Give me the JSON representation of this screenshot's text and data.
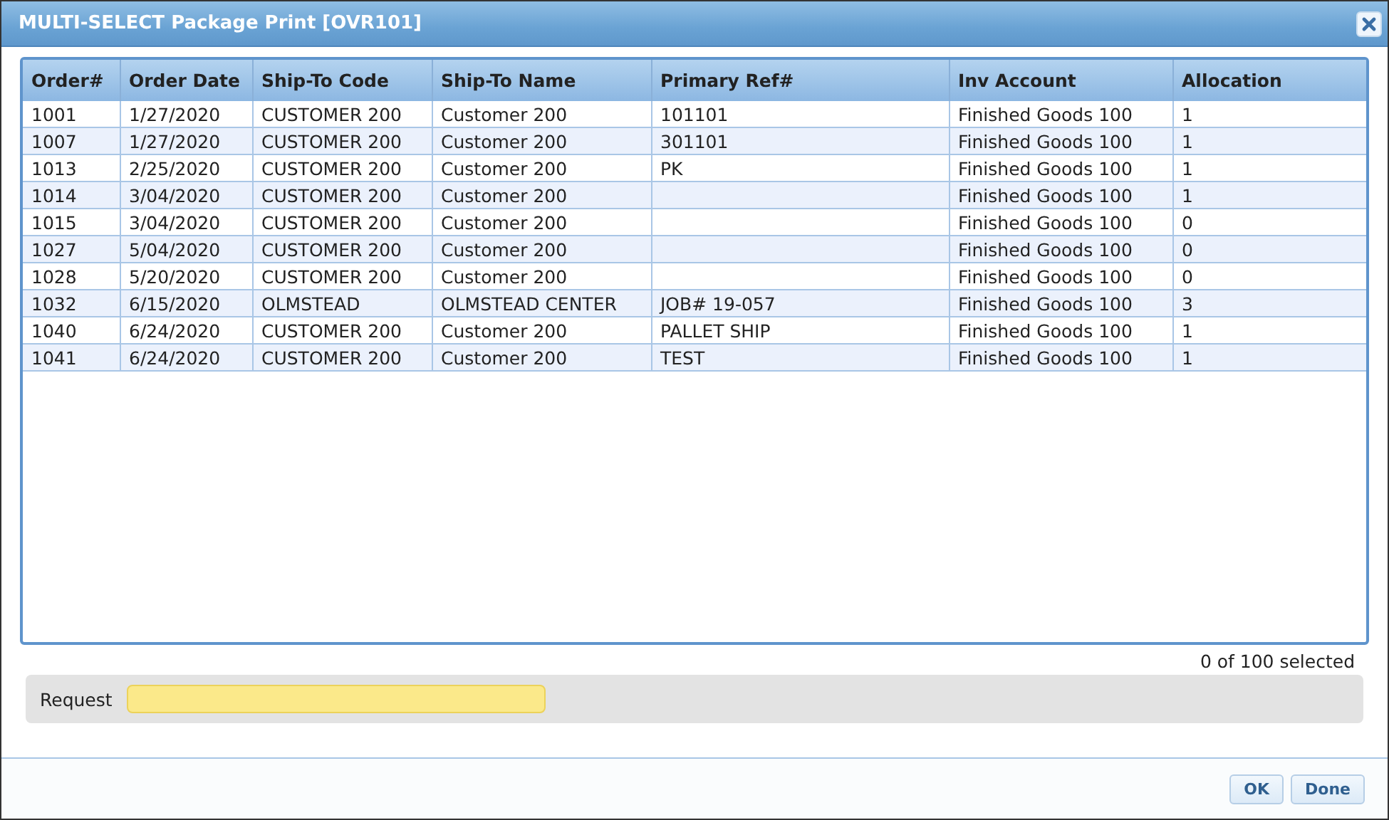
{
  "window": {
    "title": "MULTI-SELECT Package Print [OVR101]"
  },
  "table": {
    "columns": [
      "Order#",
      "Order Date",
      "Ship-To Code",
      "Ship-To Name",
      "Primary Ref#",
      "Inv Account",
      "Allocation"
    ],
    "rows": [
      [
        "1001",
        "1/27/2020",
        "CUSTOMER 200",
        "Customer 200",
        "101101",
        "Finished Goods 100",
        "1"
      ],
      [
        "1007",
        "1/27/2020",
        "CUSTOMER 200",
        "Customer 200",
        "301101",
        "Finished Goods 100",
        "1"
      ],
      [
        "1013",
        "2/25/2020",
        "CUSTOMER 200",
        "Customer 200",
        "PK",
        "Finished Goods 100",
        "1"
      ],
      [
        "1014",
        "3/04/2020",
        "CUSTOMER 200",
        "Customer 200",
        null,
        "Finished Goods 100",
        "1"
      ],
      [
        "1015",
        "3/04/2020",
        "CUSTOMER 200",
        "Customer 200",
        null,
        "Finished Goods 100",
        "0"
      ],
      [
        "1027",
        "5/04/2020",
        "CUSTOMER 200",
        "Customer 200",
        null,
        "Finished Goods 100",
        "0"
      ],
      [
        "1028",
        "5/20/2020",
        "CUSTOMER 200",
        "Customer 200",
        null,
        "Finished Goods 100",
        "0"
      ],
      [
        "1032",
        "6/15/2020",
        "OLMSTEAD",
        "OLMSTEAD CENTER",
        "JOB# 19-057",
        "Finished Goods 100",
        "3"
      ],
      [
        "1040",
        "6/24/2020",
        "CUSTOMER 200",
        "Customer 200",
        "PALLET SHIP",
        "Finished Goods 100",
        "1"
      ],
      [
        "1041",
        "6/24/2020",
        "CUSTOMER 200",
        "Customer 200",
        "TEST",
        "Finished Goods 100",
        "1"
      ]
    ]
  },
  "selection_count": "0 of 100 selected",
  "request": {
    "label": "Request"
  },
  "buttons": [
    {
      "label": "OK"
    },
    {
      "label": "Done"
    }
  ]
}
